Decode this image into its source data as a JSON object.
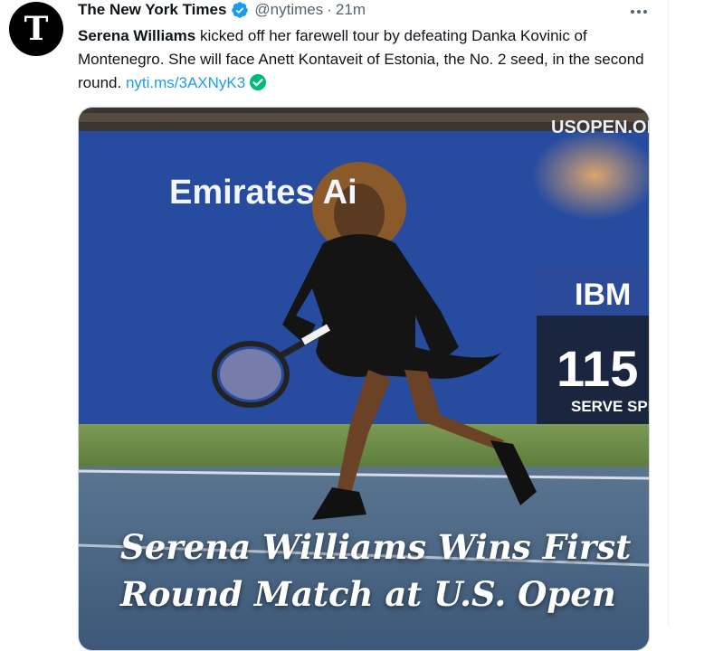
{
  "author": {
    "name": "The New York Times",
    "handle": "@nytimes",
    "separator": "·",
    "time": "21m",
    "avatar_glyph": "T",
    "verified_icon": "verified-badge-icon"
  },
  "tweet": {
    "bold_name": "Serena Williams",
    "text": " kicked off her farewell tour by defeating Danka Kovinic of Montenegro. She will face Anett Kontaveit of Estonia, the No. 2 seed, in the second round.",
    "link": "nyti.ms/3AXNyK3",
    "link_icon": "green-check-icon"
  },
  "media": {
    "signs": {
      "emirates": "Emirates Ai",
      "usopen": "USOPEN.OI",
      "ibm": "IBM",
      "speed": "115",
      "serve": "SERVE SPEE"
    },
    "headline_line1": "Serena Williams Wins First",
    "headline_line2": "Round Match at U.S. Open"
  },
  "colors": {
    "accent": "#1d9bf0",
    "muted": "#536471",
    "check_green": "#00ba7c"
  }
}
